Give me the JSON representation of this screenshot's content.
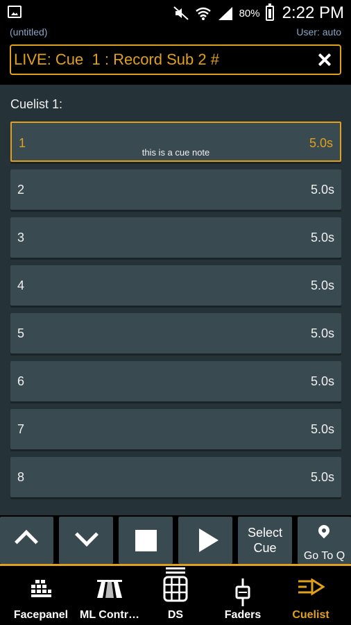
{
  "status_bar": {
    "battery_percent": "80%",
    "time": "2:22 PM",
    "icons": [
      "gallery-icon",
      "mute-icon",
      "wifi-icon",
      "signal-icon",
      "battery-icon"
    ]
  },
  "subheader": {
    "file_name": "(untitled)",
    "user": "User: auto"
  },
  "live_bar": {
    "text": "LIVE: Cue  1 : Record Sub 2 #"
  },
  "cuelist": {
    "title": "Cuelist 1:",
    "cues": [
      {
        "number": "1",
        "time": "5.0s",
        "note": "this is a cue note",
        "selected": true
      },
      {
        "number": "2",
        "time": "5.0s",
        "note": ""
      },
      {
        "number": "3",
        "time": "5.0s",
        "note": ""
      },
      {
        "number": "4",
        "time": "5.0s",
        "note": ""
      },
      {
        "number": "5",
        "time": "5.0s",
        "note": ""
      },
      {
        "number": "6",
        "time": "5.0s",
        "note": ""
      },
      {
        "number": "7",
        "time": "5.0s",
        "note": ""
      },
      {
        "number": "8",
        "time": "5.0s",
        "note": ""
      }
    ]
  },
  "controls": {
    "select_cue_line1": "Select",
    "select_cue_line2": "Cue",
    "go_to_q": "Go To Q"
  },
  "tabs": [
    {
      "label": "Facepanel",
      "icon": "facepanel-icon"
    },
    {
      "label": "ML Contr…",
      "icon": "ml-control-icon"
    },
    {
      "label": "DS",
      "icon": "ds-grid-icon"
    },
    {
      "label": "Faders",
      "icon": "fader-icon"
    },
    {
      "label": "Cuelist",
      "icon": "cuelist-icon",
      "active": true
    }
  ],
  "colors": {
    "accent": "#e0a11b",
    "panel_bg": "#253238",
    "row_bg": "#3a4a51",
    "subheader_text": "#8aa7c8"
  }
}
